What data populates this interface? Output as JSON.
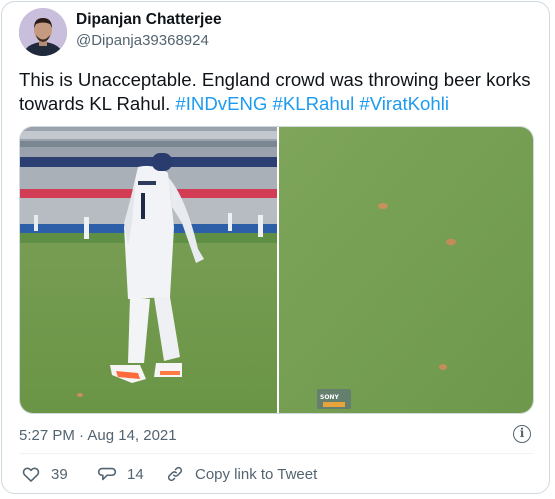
{
  "author": {
    "name": "Dipanjan Chatterjee",
    "handle": "@Dipanja39368924"
  },
  "tweet": {
    "text": "This is Unacceptable. England crowd was throwing beer korks towards KL Rahul.",
    "hashtags": [
      "#INDvENG",
      "#KLRahul",
      "#ViratKohli"
    ]
  },
  "media": {
    "left_image": "cricket fielder in white jersey number 1 on the outfield, stadium crowd behind",
    "right_image": "close-up of green outfield with several beer corks",
    "broadcast_logo_text": "SONY"
  },
  "meta": {
    "timestamp": "5:27 PM · Aug 14, 2021",
    "info_icon": "info-icon"
  },
  "actions": {
    "likes_count": "39",
    "replies_count": "14",
    "copy_link_label": "Copy link to Tweet"
  },
  "colors": {
    "hashtag": "#1d9bf0",
    "secondary_text": "#536471",
    "border": "#cfd9de"
  }
}
